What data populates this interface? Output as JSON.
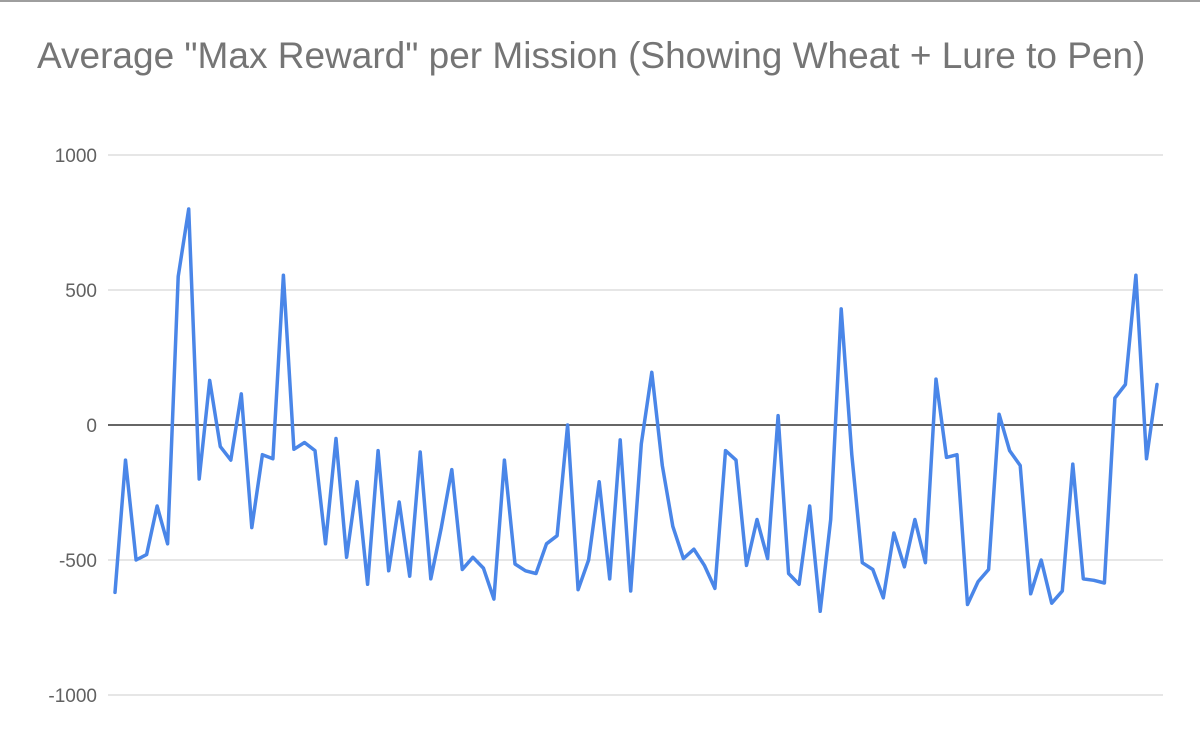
{
  "chart_data": {
    "type": "line",
    "title": "Average \"Max Reward\" per Mission (Showing Wheat + Lure to Pen)",
    "xlabel": "",
    "ylabel": "",
    "ylim": [
      -1000,
      1000
    ],
    "yticks": [
      "1000",
      "500",
      "0",
      "-500",
      "-1000"
    ],
    "grid": true,
    "legend": "none",
    "colors": {
      "series": "#4a86e8",
      "grid": "#cccccc",
      "zero_line": "#333333",
      "title": "#757575",
      "tick": "#616161"
    },
    "series": [
      {
        "values": [
          -620,
          -130,
          -500,
          -480,
          -300,
          -440,
          550,
          800,
          -200,
          165,
          -80,
          -130,
          115,
          -380,
          -110,
          -125,
          555,
          -90,
          -65,
          -95,
          -440,
          -50,
          -490,
          -210,
          -590,
          -95,
          -540,
          -285,
          -560,
          -100,
          -570,
          -380,
          -165,
          -535,
          -490,
          -530,
          -645,
          -130,
          -515,
          -540,
          -550,
          -440,
          -410,
          0,
          -610,
          -500,
          -210,
          -570,
          -55,
          -615,
          -70,
          195,
          -150,
          -375,
          -495,
          -460,
          -520,
          -605,
          -95,
          -130,
          -520,
          -350,
          -495,
          35,
          -550,
          -590,
          -300,
          -690,
          -350,
          430,
          -110,
          -510,
          -535,
          -640,
          -400,
          -525,
          -350,
          -510,
          170,
          -120,
          -110,
          -665,
          -580,
          -535,
          40,
          -95,
          -150,
          -625,
          -500,
          -660,
          -615,
          -145,
          -570,
          -575,
          -585,
          100,
          150,
          555,
          -125,
          150
        ]
      }
    ]
  }
}
